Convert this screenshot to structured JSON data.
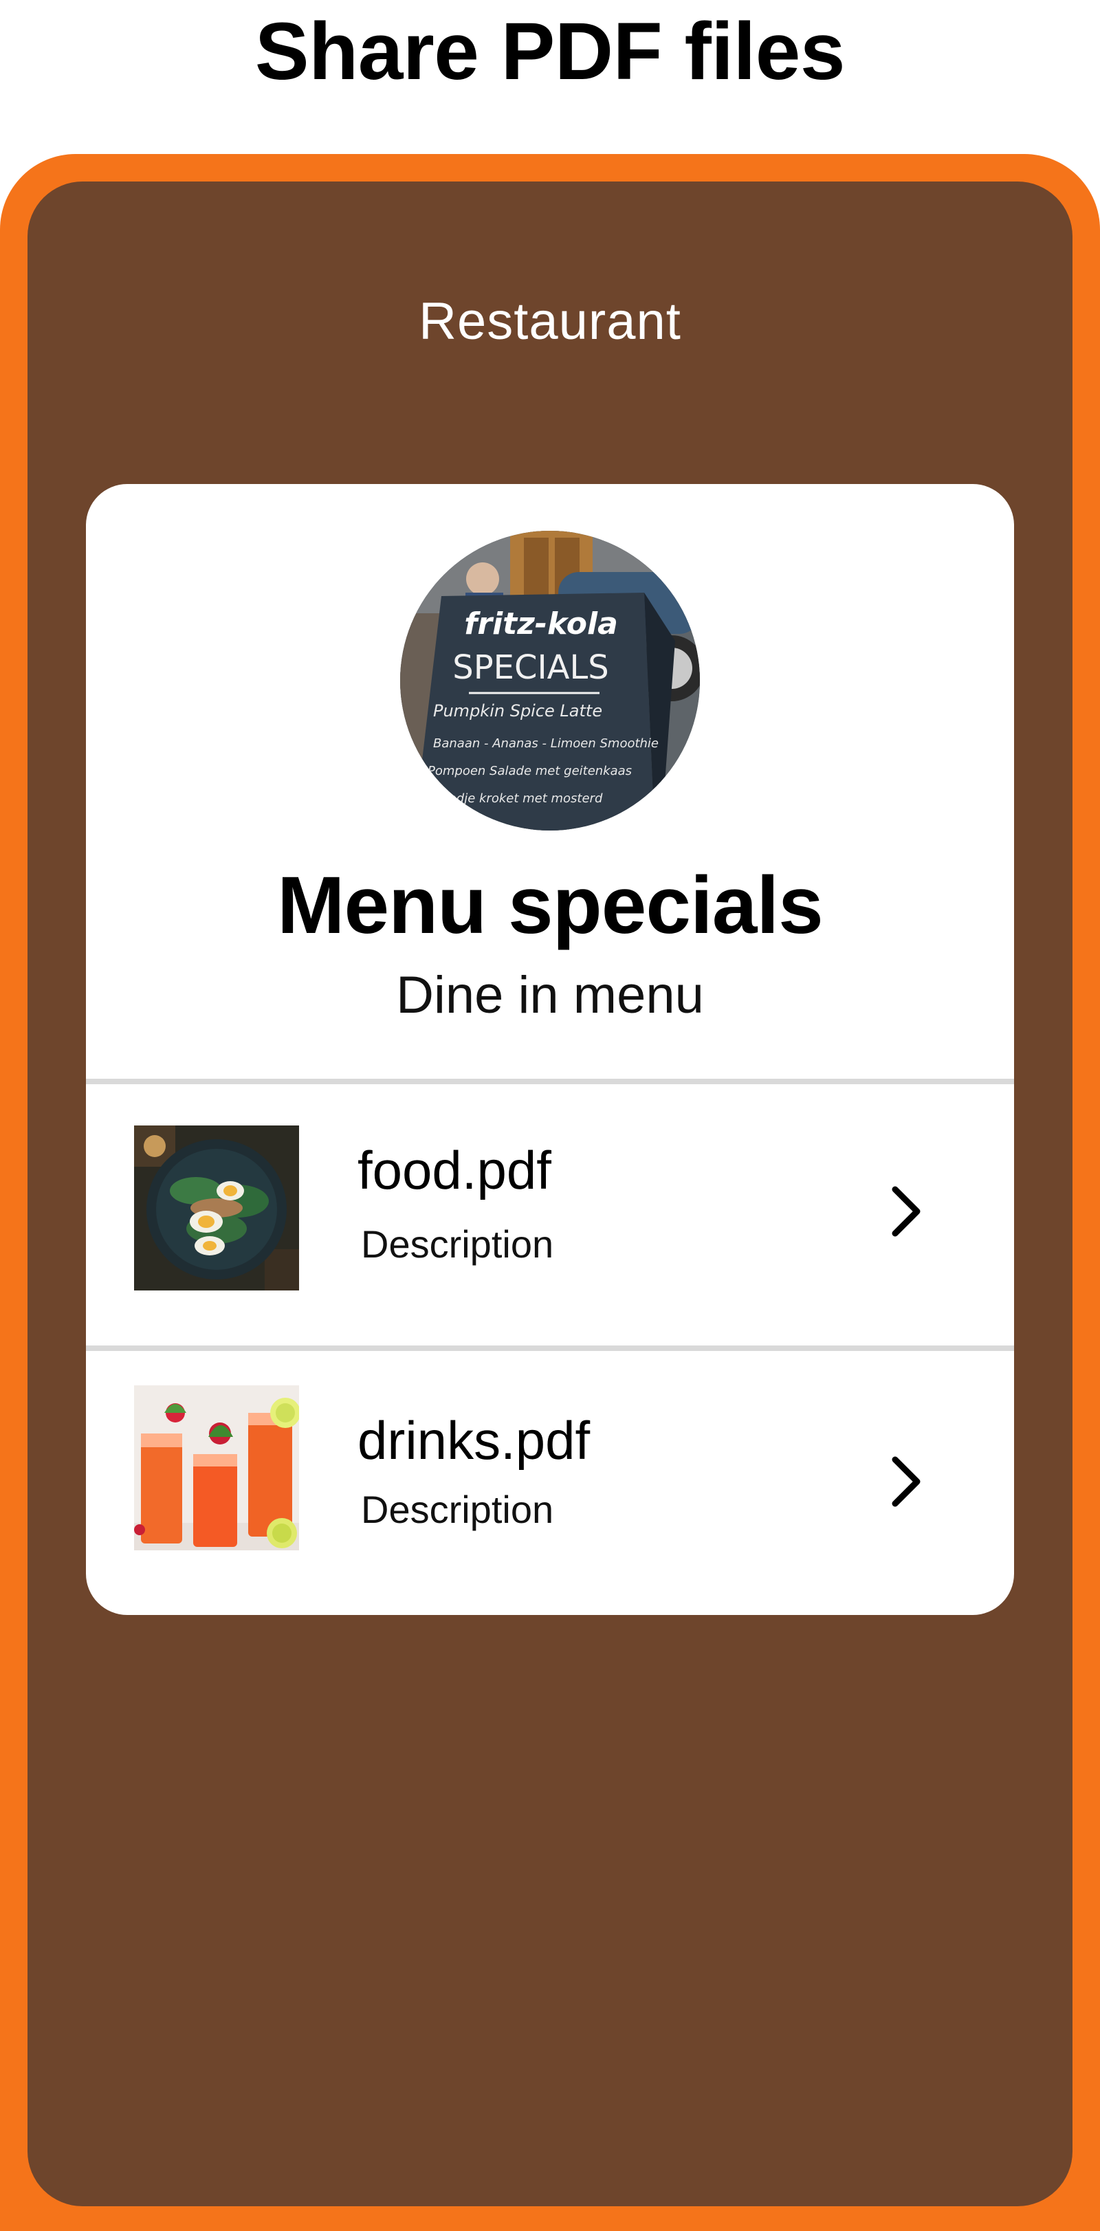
{
  "page": {
    "title": "Share PDF files"
  },
  "app": {
    "header": "Restaurant"
  },
  "card": {
    "avatar_icon": "menu-specials-chalkboard-photo",
    "avatar_text": {
      "brand": "fritz-kola",
      "heading": "SPECIALS",
      "lines": [
        "Pumpkin Spice Latte",
        "Banaan - Ananas - Limoen Smoothie",
        "Pompoen Salade met geitenkaas",
        "Broodje kroket met mosterd"
      ]
    },
    "title": "Menu specials",
    "subtitle": "Dine in menu"
  },
  "files": [
    {
      "name": "food.pdf",
      "description": "Description",
      "thumbnail_icon": "food-plate-photo",
      "chevron_icon": "chevron-right-icon"
    },
    {
      "name": "drinks.pdf",
      "description": "Description",
      "thumbnail_icon": "drinks-glasses-photo",
      "chevron_icon": "chevron-right-icon"
    }
  ],
  "colors": {
    "frame": "#F5741A",
    "screen": "#6E452C",
    "card": "#FFFFFF",
    "divider": "#D9D9D9"
  }
}
